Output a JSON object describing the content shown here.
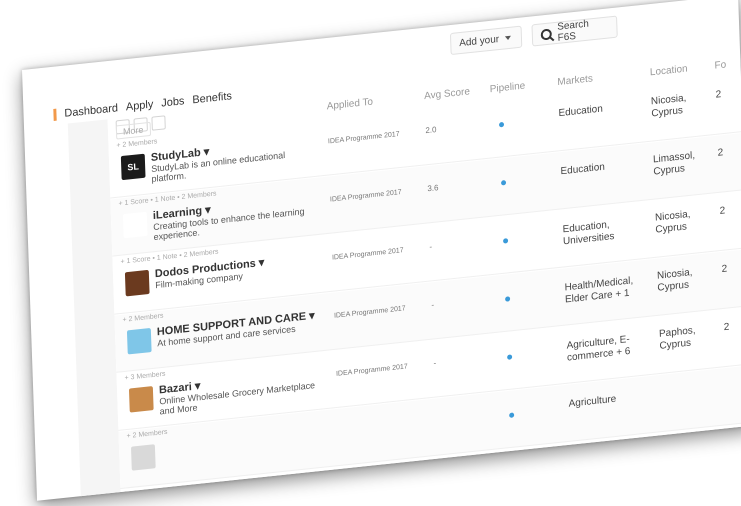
{
  "nav": {
    "items": [
      "Dashboard",
      "Apply",
      "Jobs",
      "Benefits"
    ]
  },
  "controls": {
    "add_label": "Add your",
    "search_label": "Search F6S"
  },
  "table": {
    "headers": {
      "applied": "Applied To",
      "score": "Avg Score",
      "pipeline": "Pipeline",
      "markets": "Markets",
      "location": "Location",
      "fo": "Fo"
    },
    "more_label": "More"
  },
  "rows": [
    {
      "meta": "+ 2 Members",
      "logo": "SL",
      "logo_color": "#1b1b1b",
      "name": "StudyLab ▾",
      "desc": "StudyLab is an online educational platform.",
      "applied": "IDEA Programme 2017",
      "score": "2.0",
      "market": "Education",
      "location": "Nicosia, Cyprus",
      "fo": "2"
    },
    {
      "meta": "+ 1 Score • 1 Note • 2 Members",
      "logo": "",
      "logo_color": "#ffffff",
      "name": "iLearning ▾",
      "desc": "Creating tools to enhance the learning experience.",
      "applied": "IDEA Programme 2017",
      "score": "3.6",
      "market": "Education",
      "location": "Limassol, Cyprus",
      "fo": "2"
    },
    {
      "meta": "+ 1 Score • 1 Note • 2 Members",
      "logo": "",
      "logo_color": "#6b3a1f",
      "name": "Dodos Productions ▾",
      "desc": "Film-making company",
      "applied": "IDEA Programme 2017",
      "score": "-",
      "market": "Education, Universities",
      "location": "Nicosia, Cyprus",
      "fo": "2"
    },
    {
      "meta": "+ 2 Members",
      "logo": "",
      "logo_color": "#7fc6e8",
      "name": "HOME SUPPORT AND CARE ▾",
      "desc": "At home support and care services",
      "applied": "IDEA Programme 2017",
      "score": "-",
      "market": "Health/Medical, Elder Care + 1",
      "location": "Nicosia, Cyprus",
      "fo": "2"
    },
    {
      "meta": "+ 3 Members",
      "logo": "",
      "logo_color": "#c98a4a",
      "name": "Bazari ▾",
      "desc": "Online Wholesale Grocery Marketplace and More",
      "applied": "IDEA Programme 2017",
      "score": "-",
      "market": "Agriculture, E-commerce + 6",
      "location": "Paphos, Cyprus",
      "fo": "2"
    },
    {
      "meta": "+ 2 Members",
      "logo": "",
      "logo_color": "#d9d9d9",
      "name": "",
      "desc": "",
      "applied": "",
      "score": "",
      "market": "Agriculture",
      "location": "",
      "fo": ""
    }
  ]
}
